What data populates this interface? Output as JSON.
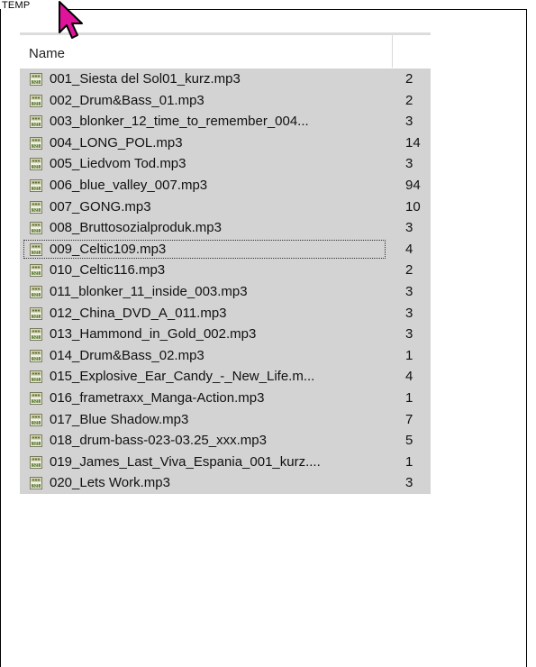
{
  "window": {
    "title": "TEMP"
  },
  "header": {
    "name_label": "Name"
  },
  "colors": {
    "row_bg": "#d3d3d3",
    "cursor": "#e0139b"
  },
  "icons": {
    "file": "mp3-file-icon",
    "cursor": "arrow-cursor-icon"
  },
  "files": [
    {
      "name": "001_Siesta del Sol01_kurz.mp3",
      "size": "2"
    },
    {
      "name": "002_Drum&Bass_01.mp3",
      "size": "2"
    },
    {
      "name": "003_blonker_12_time_to_remember_004...",
      "size": "3"
    },
    {
      "name": "004_LONG_POL.mp3",
      "size": "14"
    },
    {
      "name": "005_Liedvom Tod.mp3",
      "size": "3"
    },
    {
      "name": "006_blue_valley_007.mp3",
      "size": "94"
    },
    {
      "name": "007_GONG.mp3",
      "size": "10"
    },
    {
      "name": "008_Bruttosozialproduk.mp3",
      "size": "3"
    },
    {
      "name": "009_Celtic109.mp3",
      "size": "4"
    },
    {
      "name": "010_Celtic116.mp3",
      "size": "2"
    },
    {
      "name": "011_blonker_11_inside_003.mp3",
      "size": "3"
    },
    {
      "name": "012_China_DVD_A_011.mp3",
      "size": "3"
    },
    {
      "name": "013_Hammond_in_Gold_002.mp3",
      "size": "3"
    },
    {
      "name": "014_Drum&Bass_02.mp3",
      "size": "1"
    },
    {
      "name": "015_Explosive_Ear_Candy_-_New_Life.m...",
      "size": "4"
    },
    {
      "name": "016_frametraxx_Manga-Action.mp3",
      "size": "1"
    },
    {
      "name": "017_Blue Shadow.mp3",
      "size": "7"
    },
    {
      "name": "018_drum-bass-023-03.25_xxx.mp3",
      "size": "5"
    },
    {
      "name": "019_James_Last_Viva_Espania_001_kurz....",
      "size": "1"
    },
    {
      "name": "020_Lets Work.mp3",
      "size": "3"
    }
  ],
  "focused_index": 8
}
